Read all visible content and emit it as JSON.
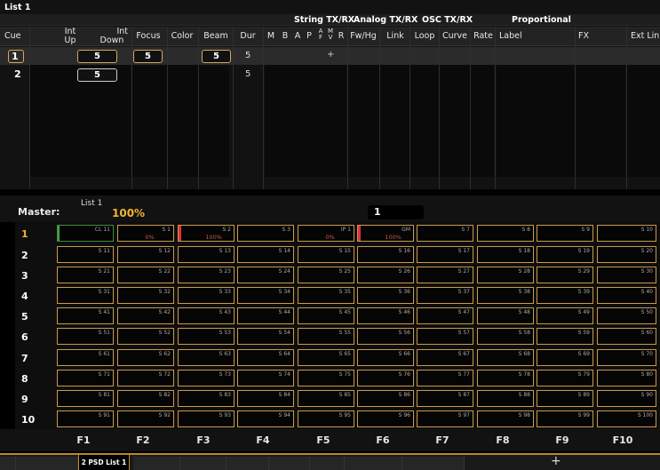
{
  "cue_list": {
    "title": "List 1",
    "group_headers": [
      "String TX/RX",
      "Analog TX/RX",
      "OSC TX/RX",
      "Proportional"
    ],
    "columns": {
      "cue": "Cue",
      "int_up": [
        "Int",
        "Up"
      ],
      "int_down": [
        "Int",
        "Down"
      ],
      "focus": "Focus",
      "color": "Color",
      "beam": "Beam",
      "dur": "Dur",
      "m": "M",
      "b": "B",
      "a": "A",
      "p": "P",
      "af": [
        "A",
        "F"
      ],
      "mv": [
        "M",
        "V"
      ],
      "r": "R",
      "fwhg": "Fw/Hg",
      "link": "Link",
      "loop": "Loop",
      "curve": "Curve",
      "rate": "Rate",
      "label": "Label",
      "fx": "FX",
      "ext_link": "Ext Link"
    },
    "rows": [
      {
        "cue": "1",
        "int_down": "5",
        "focus": "5",
        "beam": "5",
        "dur": "5",
        "mark": "+"
      },
      {
        "cue": "2",
        "int_down": "5",
        "dur": "5"
      }
    ]
  },
  "magic_sheet": {
    "master_label": "Master:",
    "list_label": "List 1",
    "master_percent": "100%",
    "command_value": "1",
    "rows": [
      {
        "label": "1",
        "cells": [
          "CL 11",
          "S 1",
          "S 2",
          "S 3",
          "IP 1",
          "GM",
          "S 7",
          "S 8",
          "S 9",
          "S 10"
        ],
        "percents": [
          "",
          "0%",
          "100%",
          "",
          "0%",
          "100%",
          "",
          "",
          "",
          ""
        ]
      },
      {
        "label": "2",
        "cells": [
          "S 11",
          "S 12",
          "S 13",
          "S 14",
          "S 15",
          "S 16",
          "S 17",
          "S 18",
          "S 19",
          "S 20"
        ]
      },
      {
        "label": "3",
        "cells": [
          "S 21",
          "S 22",
          "S 23",
          "S 24",
          "S 25",
          "S 26",
          "S 27",
          "S 28",
          "S 29",
          "S 30"
        ]
      },
      {
        "label": "4",
        "cells": [
          "S 31",
          "S 32",
          "S 33",
          "S 34",
          "S 35",
          "S 36",
          "S 37",
          "S 38",
          "S 39",
          "S 40"
        ]
      },
      {
        "label": "5",
        "cells": [
          "S 41",
          "S 42",
          "S 43",
          "S 44",
          "S 45",
          "S 46",
          "S 47",
          "S 48",
          "S 49",
          "S 50"
        ]
      },
      {
        "label": "6",
        "cells": [
          "S 51",
          "S 52",
          "S 53",
          "S 54",
          "S 55",
          "S 56",
          "S 57",
          "S 58",
          "S 59",
          "S 60"
        ]
      },
      {
        "label": "7",
        "cells": [
          "S 61",
          "S 62",
          "S 63",
          "S 64",
          "S 65",
          "S 66",
          "S 67",
          "S 68",
          "S 69",
          "S 70"
        ]
      },
      {
        "label": "8",
        "cells": [
          "S 71",
          "S 72",
          "S 73",
          "S 74",
          "S 75",
          "S 76",
          "S 77",
          "S 78",
          "S 79",
          "S 80"
        ]
      },
      {
        "label": "9",
        "cells": [
          "S 81",
          "S 82",
          "S 83",
          "S 84",
          "S 85",
          "S 86",
          "S 87",
          "S 88",
          "S 89",
          "S 90"
        ]
      },
      {
        "label": "10",
        "cells": [
          "S 91",
          "S 92",
          "S 93",
          "S 94",
          "S 95",
          "S 96",
          "S 97",
          "S 98",
          "S 99",
          "S 100"
        ]
      }
    ],
    "function_keys": [
      "F1",
      "F2",
      "F3",
      "F4",
      "F5",
      "F6",
      "F7",
      "F8",
      "F9",
      "F10"
    ]
  },
  "tabs": {
    "items": [
      "",
      "",
      "2 PSD List 1",
      "",
      "",
      "",
      "",
      "",
      "",
      ""
    ],
    "selected": "2 PSD List 1",
    "add": "+"
  },
  "colors": {
    "accent": "#f2b233",
    "cell_border": "#c89a4e",
    "red_marker": "#e0323a",
    "green_marker": "#4aa04a"
  }
}
